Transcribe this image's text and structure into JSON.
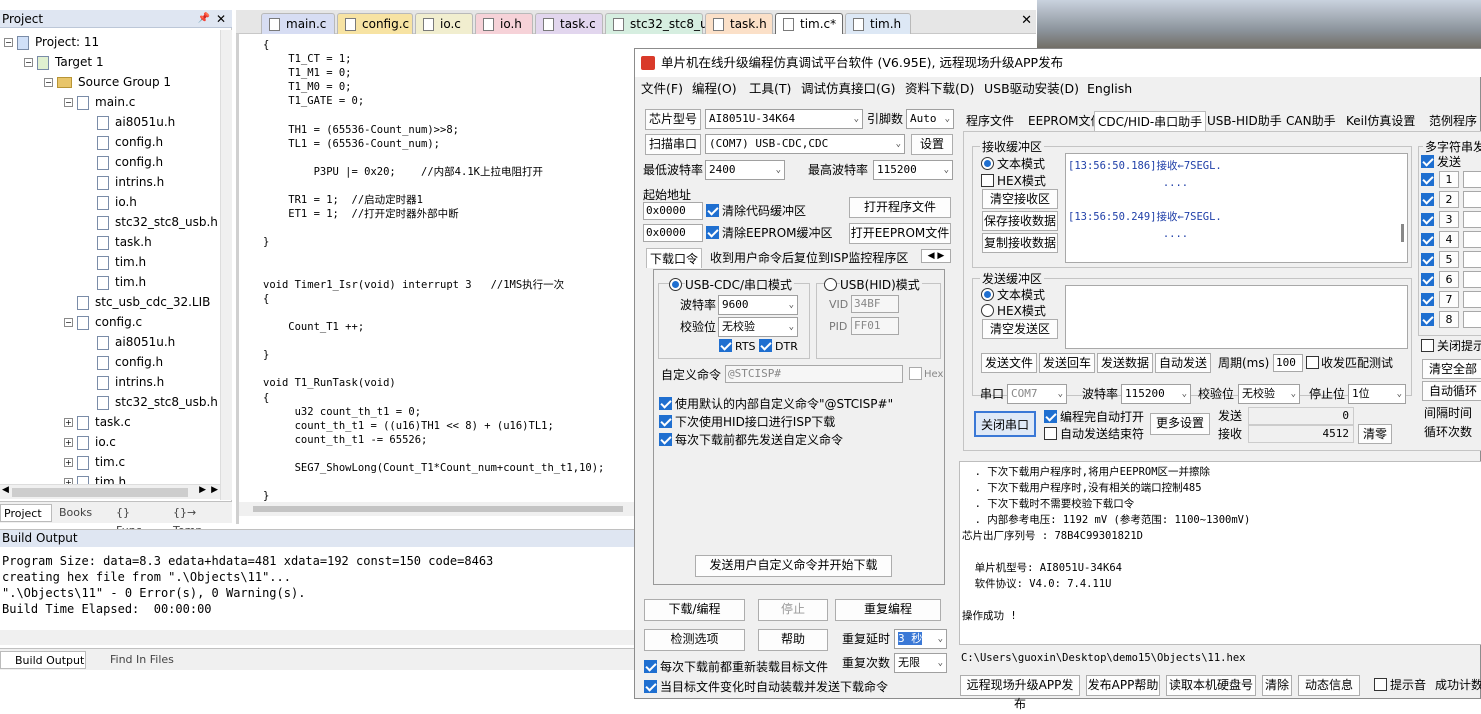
{
  "project": {
    "header": "Project",
    "tree": [
      {
        "label": "Project: 11",
        "icon": "project-icon",
        "indent": 0,
        "expander": "−"
      },
      {
        "label": "Target 1",
        "icon": "target-icon",
        "indent": 1,
        "expander": "−"
      },
      {
        "label": "Source Group 1",
        "icon": "folder-icon",
        "indent": 2,
        "expander": "−"
      },
      {
        "label": "main.c",
        "icon": "file-icon",
        "indent": 3,
        "expander": "−"
      },
      {
        "label": "ai8051u.h",
        "icon": "file-icon",
        "indent": 4,
        "expander": ""
      },
      {
        "label": "config.h",
        "icon": "file-icon",
        "indent": 4,
        "expander": ""
      },
      {
        "label": "config.h",
        "icon": "file-icon",
        "indent": 4,
        "expander": ""
      },
      {
        "label": "intrins.h",
        "icon": "file-icon",
        "indent": 4,
        "expander": ""
      },
      {
        "label": "io.h",
        "icon": "file-icon",
        "indent": 4,
        "expander": ""
      },
      {
        "label": "stc32_stc8_usb.h",
        "icon": "file-icon",
        "indent": 4,
        "expander": ""
      },
      {
        "label": "task.h",
        "icon": "file-icon",
        "indent": 4,
        "expander": ""
      },
      {
        "label": "tim.h",
        "icon": "file-icon",
        "indent": 4,
        "expander": ""
      },
      {
        "label": "tim.h",
        "icon": "file-icon",
        "indent": 4,
        "expander": ""
      },
      {
        "label": "stc_usb_cdc_32.LIB",
        "icon": "file-icon",
        "indent": 3,
        "expander": ""
      },
      {
        "label": "config.c",
        "icon": "file-icon",
        "indent": 3,
        "expander": "−"
      },
      {
        "label": "ai8051u.h",
        "icon": "file-icon",
        "indent": 4,
        "expander": ""
      },
      {
        "label": "config.h",
        "icon": "file-icon",
        "indent": 4,
        "expander": ""
      },
      {
        "label": "intrins.h",
        "icon": "file-icon",
        "indent": 4,
        "expander": ""
      },
      {
        "label": "stc32_stc8_usb.h",
        "icon": "file-icon",
        "indent": 4,
        "expander": ""
      },
      {
        "label": "task.c",
        "icon": "file-icon",
        "indent": 3,
        "expander": "+"
      },
      {
        "label": "io.c",
        "icon": "file-icon",
        "indent": 3,
        "expander": "+"
      },
      {
        "label": "tim.c",
        "icon": "file-icon",
        "indent": 3,
        "expander": "+"
      },
      {
        "label": "tim.h",
        "icon": "file-icon",
        "indent": 3,
        "expander": "+"
      }
    ],
    "tabs": [
      "Project",
      "Books",
      "{} Func...",
      "{}→ Temp..."
    ]
  },
  "editor": {
    "tabs": [
      {
        "label": "main.c",
        "color": "#d7ddf3"
      },
      {
        "label": "config.c",
        "color": "#f7e3a3"
      },
      {
        "label": "io.c",
        "color": "#f1eecf"
      },
      {
        "label": "io.h",
        "color": "#f6d2d8"
      },
      {
        "label": "task.c",
        "color": "#e2d6ee"
      },
      {
        "label": "stc32_stc8_usb.h",
        "color": "#d6eee0"
      },
      {
        "label": "task.h",
        "color": "#fbe0c8"
      },
      {
        "label": "tim.c*",
        "color": "#ffffff"
      },
      {
        "label": "tim.h",
        "color": "#dde8f5"
      }
    ],
    "lines": [
      "{",
      "    T1_CT = 1;",
      "    T1_M1 = 0;",
      "    T1_M0 = 0;",
      "    T1_GATE = 0;",
      "",
      "    TH1 = (65536-Count_num)>>8;",
      "    TL1 = (65536-Count_num);",
      "",
      "        P3PU |= 0x20;    //内部4.1K上拉电阻打开",
      "",
      "    TR1 = 1;  //启动定时器1",
      "    ET1 = 1;  //打开定时器外部中断",
      "",
      "}",
      "",
      "",
      "void Timer1_Isr(void) interrupt 3   //1MS执行一次",
      "{",
      "",
      "    Count_T1 ++;",
      "",
      "}",
      "",
      "void T1_RunTask(void)",
      "{",
      "     u32 count_th_t1 = 0;",
      "     count_th_t1 = ((u16)TH1 << 8) + (u16)TL1;",
      "     count_th_t1 -= 65526;",
      "",
      "     SEG7_ShowLong(Count_T1*Count_num+count_th_t1,10);",
      "",
      "}"
    ]
  },
  "build": {
    "header": "Build Output",
    "lines": [
      "Program Size: data=8.3 edata+hdata=481 xdata=192 const=150 code=8463",
      "creating hex file from \".\\Objects\\11\"...",
      "\".\\Objects\\11\" - 0 Error(s), 0 Warning(s).",
      "Build Time Elapsed:  00:00:00"
    ],
    "tabs": [
      "Build Output",
      "Find In Files"
    ]
  },
  "isp": {
    "title": "单片机在线升级编程仿真调试平台软件 (V6.95E), 远程现场升级APP发布",
    "menu": [
      "文件(F)",
      "编程(O)",
      "工具(T)",
      "调试仿真接口(G)",
      "资料下载(D)",
      "USB驱动安装(D)",
      "English"
    ],
    "chip_label": "芯片型号",
    "chip_value": "AI8051U-34K64",
    "pin_label": "引脚数",
    "pin_value": "Auto",
    "scan_label": "扫描串口",
    "port_value": "(COM7) USB-CDC,CDC",
    "settings_btn": "设置",
    "min_baud_label": "最低波特率",
    "min_baud_value": "2400",
    "max_baud_label": "最高波特率",
    "max_baud_value": "115200",
    "start_addr_label": "起始地址",
    "addr1": "0x0000",
    "clear_code": "清除代码缓冲区",
    "open_prog": "打开程序文件",
    "addr2": "0x0000",
    "clear_eeprom": "清除EEPROM缓冲区",
    "open_eeprom": "打开EEPROM文件",
    "lower_tabs": [
      "下载口令",
      "收到用户命令后复位到ISP监控程序区"
    ],
    "usb_cdc_mode": "USB-CDC/串口模式",
    "usb_hid_mode": "USB(HID)模式",
    "baud_label": "波特率",
    "baud_value": "9600",
    "parity_label": "校验位",
    "parity_value": "无校验",
    "rts": "RTS",
    "dtr": "DTR",
    "vid_label": "VID",
    "vid_value": "34BF",
    "pid_label": "PID",
    "pid_value": "FF01",
    "custom_cmd_label": "自定义命令",
    "custom_cmd_value": "@STCISP#",
    "hex_label": "Hex",
    "opt1": "使用默认的内部自定义命令\"@STCISP#\"",
    "opt2": "下次使用HID接口进行ISP下载",
    "opt3": "每次下载前都先发送自定义命令",
    "send_cmd_btn": "发送用户自定义命令并开始下载",
    "download_btn": "下载/编程",
    "stop_btn": "停止",
    "reprogram_btn": "重复编程",
    "check_btn": "检测选项",
    "help_btn": "帮助",
    "delay_label": "重复延时",
    "delay_value": "3 秒",
    "count_label": "重复次数",
    "count_value": "无限",
    "reload_opt": "每次下载前都重新装载目标文件",
    "auto_opt": "当目标文件变化时自动装载并发送下载命令",
    "right_tabs": [
      "程序文件",
      "EEPROM文件",
      "CDC/HID-串口助手",
      "USB-HID助手",
      "CAN助手",
      "Keil仿真设置",
      "范例程序"
    ],
    "rx_group": "接收缓冲区",
    "text_mode": "文本模式",
    "hex_mode": "HEX模式",
    "clear_rx": "清空接收区",
    "save_rx": "保存接收数据",
    "copy_rx": "复制接收数据",
    "rx_lines": [
      "[13:56:50.186]接收←7SEGL.",
      "               ....",
      "",
      "[13:56:50.249]接收←7SEGL.",
      "               ...."
    ],
    "tx_group": "发送缓冲区",
    "clear_tx": "清空发送区",
    "send_file": "发送文件",
    "send_return": "发送回车",
    "send_data": "发送数据",
    "auto_send": "自动发送",
    "period_label": "周期(ms)",
    "period_value": "100",
    "match_label": "收发匹配测试",
    "port_label": "串口",
    "port_sel": "COM7",
    "baud2_label": "波特率",
    "baud2_value": "115200",
    "parity2_label": "校验位",
    "parity2_value": "无校验",
    "stop_label": "停止位",
    "stop_value": "1位",
    "close_port": "关闭串口",
    "auto_open": "编程完自动打开",
    "auto_end": "自动发送结束符",
    "more_settings": "更多设置",
    "send_label": "发送",
    "send_count": "0",
    "recv_label": "接收",
    "recv_count": "4512",
    "clear_counts": "清零",
    "multi_group": "多字符串发",
    "multi_send": "发送",
    "multi_rows": [
      "1",
      "2",
      "3",
      "4",
      "5",
      "6",
      "7",
      "8"
    ],
    "close_hint": "关闭提示",
    "clear_all": "清空全部",
    "auto_loop": "自动循环",
    "interval_label": "间隔时间",
    "loop_count_label": "循环次数",
    "log_lines": [
      "  . 下次下载用户程序时,将用户EEPROM区一并擦除",
      "  . 下次下载用户程序时,没有相关的端口控制485",
      "  . 下次下载时不需要校验下载口令",
      "  . 内部参考电压: 1192 mV (参考范围: 1100~1300mV)",
      "芯片出厂序列号 : 78B4C99301821D",
      "",
      "  单片机型号: AI8051U-34K64",
      "  软件协议: V4.0: 7.4.11U",
      "",
      "操作成功 !"
    ],
    "file_path": "C:\\Users\\guoxin\\Desktop\\demo15\\Objects\\11.hex",
    "bottom_btns": [
      "远程现场升级APP发布",
      "发布APP帮助",
      "读取本机硬盘号",
      "清除",
      "动态信息"
    ],
    "hint_label": "提示音",
    "success_label": "成功计数"
  }
}
